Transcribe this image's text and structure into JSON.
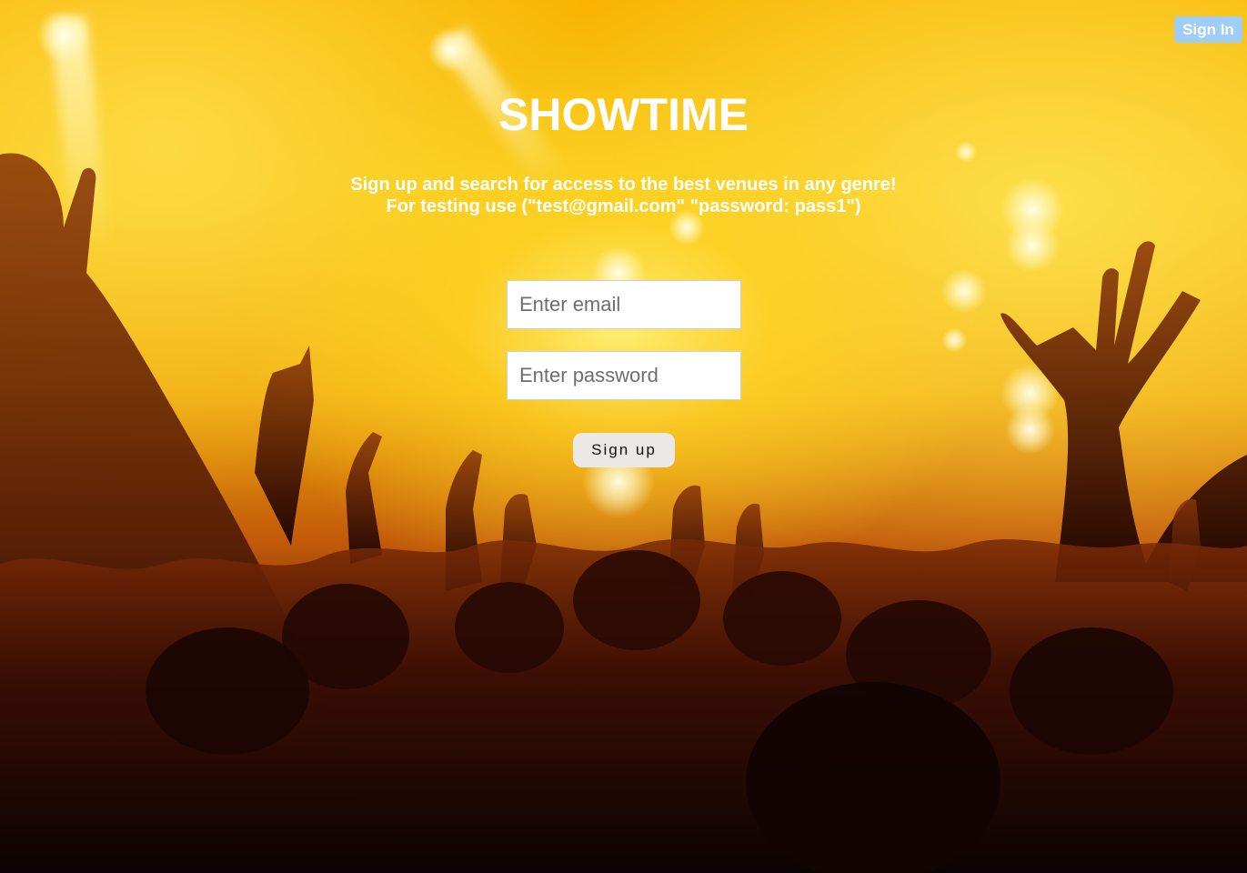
{
  "header": {
    "signin_label": "Sign In"
  },
  "hero": {
    "title": "SHOWTIME",
    "subtitle_line1": "Sign up and search for access to the best venues in any genre!",
    "subtitle_line2": "For testing use (\"test@gmail.com\" \"password: pass1\")"
  },
  "form": {
    "email_placeholder": "Enter email",
    "email_value": "",
    "password_placeholder": "Enter password",
    "password_value": "",
    "submit_label": "Sign up"
  },
  "colors": {
    "signin_button": "#9fcdf8",
    "signup_button": "#ebe8e6",
    "text": "#ffffff"
  }
}
